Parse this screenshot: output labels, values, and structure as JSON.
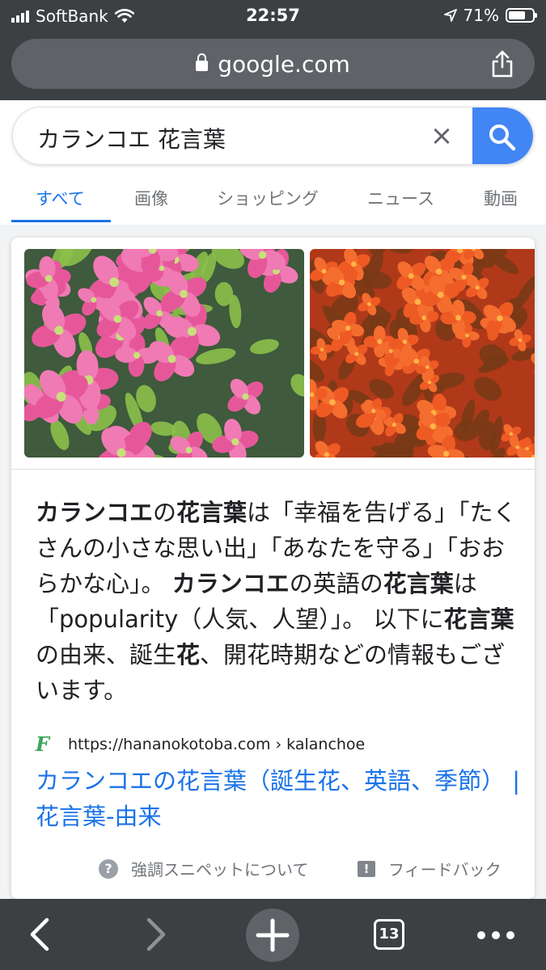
{
  "status_bar": {
    "carrier": "SoftBank",
    "time": "22:57",
    "battery_text": "71%",
    "battery_level": 0.71,
    "signal_bars": 4
  },
  "browser": {
    "url": "google.com",
    "open_tabs": "13"
  },
  "search": {
    "query": "カランコエ 花言葉",
    "clear_symbol": "×"
  },
  "tabs": [
    {
      "label": "すべて",
      "active": true
    },
    {
      "label": "画像"
    },
    {
      "label": "ショッピング"
    },
    {
      "label": "ニュース"
    },
    {
      "label": "動画"
    }
  ],
  "snippet": {
    "segments": [
      {
        "text": "カランコエ",
        "bold": true
      },
      {
        "text": "の",
        "bold": false
      },
      {
        "text": "花言葉",
        "bold": true
      },
      {
        "text": "は「幸福を告げる」「たくさんの小さな思い出」「あなたを守る」「おおらかな心」。 ",
        "bold": false
      },
      {
        "text": "カランコエ",
        "bold": true
      },
      {
        "text": "の英語の",
        "bold": false
      },
      {
        "text": "花言葉",
        "bold": true
      },
      {
        "text": "は「popularity（人気、人望）」。 以下に",
        "bold": false
      },
      {
        "text": "花言葉",
        "bold": true
      },
      {
        "text": "の由来、誕生",
        "bold": false
      },
      {
        "text": "花",
        "bold": true
      },
      {
        "text": "、開花時期などの情報もございます。",
        "bold": false
      }
    ],
    "source_url": "https://hananokotoba.com › kalanchoe",
    "favicon_letter": "F",
    "result_title": "カランコエの花言葉（誕生花、英語、季節） | 花言葉-由来"
  },
  "footer": {
    "about_label": "強調スニペットについて",
    "feedback_label": "フィードバック"
  },
  "colors": {
    "accent": "#1a73e8",
    "search_button": "#4285f4",
    "chrome_dark": "#3c4043",
    "pink_flower": "#e6579a",
    "orange_flower": "#ee5a24"
  }
}
